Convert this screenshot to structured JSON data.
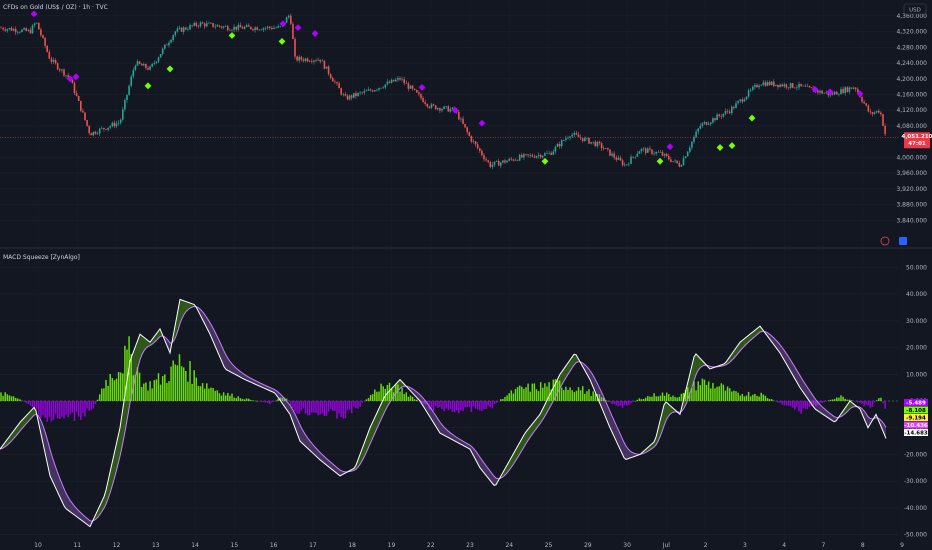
{
  "header": {
    "symbol_title": "CFDs on Gold (US$ / OZ) · 1h · TVC",
    "currency": "USD",
    "indicator_title": "MACD Squeeze [ZynAlgo]"
  },
  "colors": {
    "background": "#131722",
    "bull_candle": "#26a69a",
    "bear_candle": "#ef5350",
    "bull_hist": "#76ff03",
    "bear_hist": "#aa00ff",
    "macd_line": "#ffffff",
    "signal_line": "#c77dff",
    "buy_marker": "#76ff03",
    "sell_marker": "#b100ff"
  },
  "chart_data": [
    {
      "type": "candlestick",
      "title": "CFDs on Gold (US$ / OZ) · 1h · TVC",
      "ylim": [
        3800,
        4380
      ],
      "y_ticks": [
        "4,360.000",
        "4,320.000",
        "4,280.000",
        "4,240.000",
        "4,200.000",
        "4,160.000",
        "4,120.000",
        "4,080.000",
        "4,000.000",
        "3,960.000",
        "3,920.000",
        "3,880.000",
        "3,840.000"
      ],
      "x_ticks": [
        "10",
        "11",
        "12",
        "13",
        "14",
        "15",
        "16",
        "17",
        "18",
        "19",
        "22",
        "23",
        "24",
        "25",
        "29",
        "30",
        "Jul",
        "2",
        "3",
        "4",
        "7",
        "8",
        "9"
      ],
      "close_waypoints": [
        [
          0,
          4330
        ],
        [
          30,
          4320
        ],
        [
          36,
          4345
        ],
        [
          50,
          4250
        ],
        [
          70,
          4200
        ],
        [
          90,
          4060
        ],
        [
          120,
          4090
        ],
        [
          135,
          4240
        ],
        [
          150,
          4225
        ],
        [
          175,
          4320
        ],
        [
          200,
          4340
        ],
        [
          230,
          4330
        ],
        [
          280,
          4330
        ],
        [
          290,
          4365
        ],
        [
          295,
          4250
        ],
        [
          320,
          4250
        ],
        [
          345,
          4150
        ],
        [
          370,
          4170
        ],
        [
          400,
          4200
        ],
        [
          430,
          4130
        ],
        [
          455,
          4120
        ],
        [
          470,
          4050
        ],
        [
          490,
          3980
        ],
        [
          520,
          4000
        ],
        [
          550,
          4010
        ],
        [
          570,
          4060
        ],
        [
          600,
          4030
        ],
        [
          625,
          3980
        ],
        [
          640,
          4020
        ],
        [
          660,
          4010
        ],
        [
          680,
          3980
        ],
        [
          700,
          4080
        ],
        [
          730,
          4120
        ],
        [
          760,
          4190
        ],
        [
          800,
          4180
        ],
        [
          830,
          4160
        ],
        [
          855,
          4180
        ],
        [
          870,
          4110
        ],
        [
          880,
          4120
        ],
        [
          886,
          4050
        ]
      ],
      "last_price": "4,051.210",
      "last_change": "47:01",
      "buy_signals": [
        [
          148,
          4182
        ],
        [
          170,
          4225
        ],
        [
          232,
          4310
        ],
        [
          282,
          4295
        ],
        [
          545,
          3990
        ],
        [
          660,
          3990
        ],
        [
          720,
          4025
        ],
        [
          732,
          4030
        ],
        [
          752,
          4100
        ]
      ],
      "sell_signals": [
        [
          34,
          4365
        ],
        [
          70,
          4200
        ],
        [
          76,
          4205
        ],
        [
          283,
          4340
        ],
        [
          298,
          4330
        ],
        [
          315,
          4315
        ],
        [
          422,
          4178
        ],
        [
          455,
          4120
        ],
        [
          482,
          4087
        ],
        [
          670,
          4027
        ],
        [
          815,
          4173
        ],
        [
          830,
          4167
        ],
        [
          860,
          4162
        ]
      ],
      "grid": true
    },
    {
      "type": "bar",
      "title": "MACD Squeeze [ZynAlgo]",
      "ylim": [
        -52,
        52
      ],
      "y_ticks": [
        "50.000",
        "40.000",
        "30.000",
        "20.000",
        "10.000",
        "0.000",
        "-10.000",
        "-20.000",
        "-30.000",
        "-40.000",
        "-50.000"
      ],
      "macd_waypoints": [
        [
          0,
          -18
        ],
        [
          20,
          -8
        ],
        [
          35,
          -2
        ],
        [
          50,
          -28
        ],
        [
          65,
          -40
        ],
        [
          90,
          -47
        ],
        [
          105,
          -35
        ],
        [
          120,
          -10
        ],
        [
          130,
          15
        ],
        [
          140,
          25
        ],
        [
          150,
          22
        ],
        [
          160,
          27
        ],
        [
          170,
          18
        ],
        [
          180,
          38
        ],
        [
          195,
          36
        ],
        [
          210,
          25
        ],
        [
          225,
          12
        ],
        [
          245,
          8
        ],
        [
          275,
          3
        ],
        [
          290,
          -5
        ],
        [
          300,
          -15
        ],
        [
          320,
          -22
        ],
        [
          340,
          -28
        ],
        [
          355,
          -25
        ],
        [
          370,
          -10
        ],
        [
          385,
          2
        ],
        [
          400,
          8
        ],
        [
          420,
          0
        ],
        [
          440,
          -12
        ],
        [
          470,
          -18
        ],
        [
          480,
          -25
        ],
        [
          495,
          -32
        ],
        [
          510,
          -22
        ],
        [
          525,
          -12
        ],
        [
          540,
          -5
        ],
        [
          560,
          10
        ],
        [
          575,
          18
        ],
        [
          590,
          8
        ],
        [
          610,
          -10
        ],
        [
          625,
          -22
        ],
        [
          640,
          -20
        ],
        [
          655,
          -15
        ],
        [
          665,
          0
        ],
        [
          680,
          -5
        ],
        [
          695,
          18
        ],
        [
          710,
          12
        ],
        [
          725,
          14
        ],
        [
          740,
          22
        ],
        [
          760,
          28
        ],
        [
          780,
          18
        ],
        [
          800,
          5
        ],
        [
          815,
          -3
        ],
        [
          835,
          -8
        ],
        [
          850,
          0
        ],
        [
          860,
          -3
        ],
        [
          868,
          -10
        ],
        [
          876,
          -5
        ],
        [
          886,
          -14
        ]
      ],
      "hist_waypoints": [
        [
          0,
          3
        ],
        [
          15,
          2
        ],
        [
          30,
          -2
        ],
        [
          50,
          -8
        ],
        [
          80,
          -6
        ],
        [
          95,
          -2
        ],
        [
          105,
          8
        ],
        [
          115,
          12
        ],
        [
          130,
          20
        ],
        [
          145,
          6
        ],
        [
          165,
          10
        ],
        [
          180,
          16
        ],
        [
          200,
          8
        ],
        [
          225,
          3
        ],
        [
          245,
          1
        ],
        [
          270,
          -1
        ],
        [
          285,
          2
        ],
        [
          295,
          -4
        ],
        [
          320,
          -5
        ],
        [
          345,
          -6
        ],
        [
          360,
          -2
        ],
        [
          380,
          6
        ],
        [
          400,
          5
        ],
        [
          415,
          1
        ],
        [
          430,
          -3
        ],
        [
          460,
          -4
        ],
        [
          490,
          -3
        ],
        [
          505,
          2
        ],
        [
          520,
          5
        ],
        [
          540,
          6
        ],
        [
          560,
          7
        ],
        [
          580,
          5
        ],
        [
          600,
          2
        ],
        [
          620,
          -3
        ],
        [
          640,
          1
        ],
        [
          660,
          3
        ],
        [
          680,
          2
        ],
        [
          700,
          8
        ],
        [
          720,
          6
        ],
        [
          735,
          3
        ],
        [
          760,
          3
        ],
        [
          780,
          -1
        ],
        [
          800,
          -4
        ],
        [
          820,
          -1
        ],
        [
          840,
          2
        ],
        [
          860,
          -1
        ],
        [
          870,
          -3
        ],
        [
          880,
          2
        ],
        [
          886,
          -4
        ]
      ],
      "value_labels": [
        {
          "text": "-5.489",
          "color": "#aa00ff"
        },
        {
          "text": "-8.108",
          "color": "#76ff03"
        },
        {
          "text": "-9.194",
          "color": "#ffeb3b"
        },
        {
          "text": "-10.436",
          "color": "#e040fb"
        },
        {
          "text": "-14.683",
          "color": "#ffffff"
        }
      ]
    }
  ]
}
